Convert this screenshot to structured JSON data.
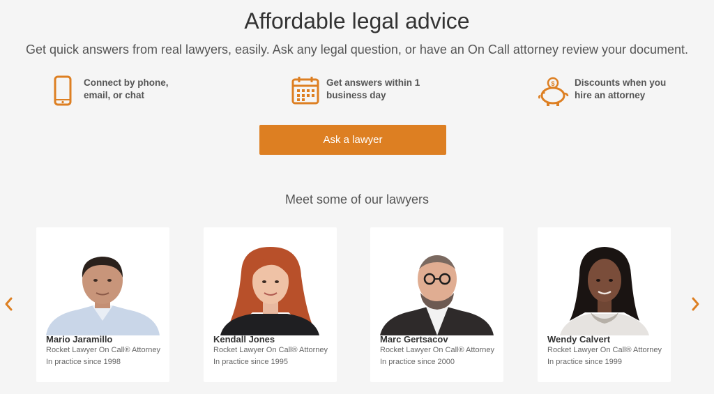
{
  "header": {
    "title": "Affordable legal advice",
    "subtitle": "Get quick answers from real lawyers, easily. Ask any legal question, or have an On Call attorney review your document."
  },
  "features": [
    {
      "icon": "phone-icon",
      "line1": "Connect by phone,",
      "line2": "email, or chat"
    },
    {
      "icon": "calendar-icon",
      "line1": "Get answers within 1",
      "line2": "business day"
    },
    {
      "icon": "piggy-bank-icon",
      "line1": "Discounts when you",
      "line2": "hire an attorney"
    }
  ],
  "cta": {
    "label": "Ask a lawyer"
  },
  "lawyers_section": {
    "title": "Meet some of our lawyers",
    "prev_icon": "chevron-left-icon",
    "next_icon": "chevron-right-icon",
    "cards": [
      {
        "name": "Mario Jaramillo",
        "role": "Rocket Lawyer On Call® Attorney",
        "since": "In practice since 1998"
      },
      {
        "name": "Kendall Jones",
        "role": "Rocket Lawyer On Call® Attorney",
        "since": "In practice since 1995"
      },
      {
        "name": "Marc Gertsacov",
        "role": "Rocket Lawyer On Call® Attorney",
        "since": "In practice since 2000"
      },
      {
        "name": "Wendy Calvert",
        "role": "Rocket Lawyer On Call® Attorney",
        "since": "In practice since 1999"
      }
    ]
  },
  "colors": {
    "accent": "#dd7f22",
    "background": "#f5f5f5",
    "card": "#ffffff",
    "text": "#333333"
  }
}
